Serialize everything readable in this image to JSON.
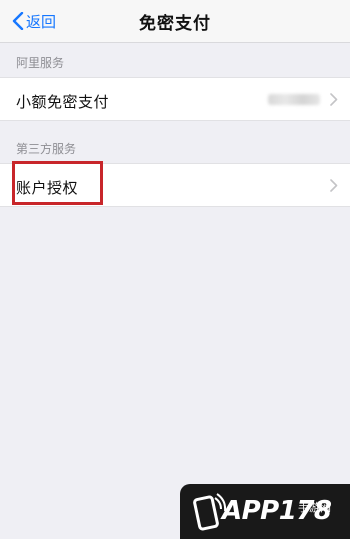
{
  "navbar": {
    "back_label": "返回",
    "title": "免密支付"
  },
  "sections": [
    {
      "header": "阿里服务",
      "items": [
        {
          "label": "小额免密支付"
        }
      ]
    },
    {
      "header": "第三方服务",
      "items": [
        {
          "label": "账户授权"
        }
      ]
    }
  ],
  "colors": {
    "accent": "#1677ff",
    "highlight": "#c8262a",
    "background": "#efeff4"
  },
  "watermark": {
    "text": "APP178",
    "subtext": "手游网"
  }
}
